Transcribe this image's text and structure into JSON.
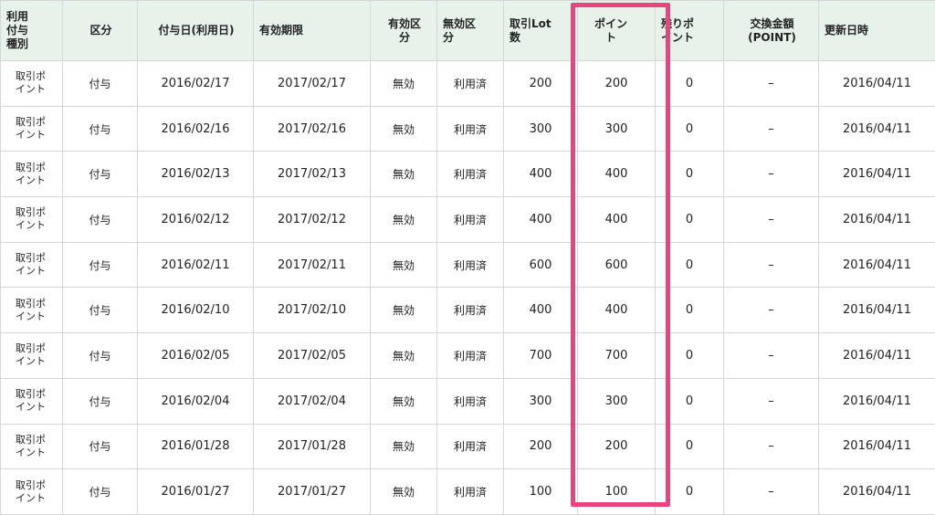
{
  "table": {
    "headers": [
      "利用\n付与\n種別",
      "区分",
      "付与日(利用日)",
      "有効期限",
      "有効区\n分",
      "無効区\n分",
      "取引Lot\n数",
      "ポイン\nト",
      "残りポ\nイント",
      "交換金額\n(POINT)",
      "更新日時"
    ],
    "rows": [
      [
        "取引ポ\nイント",
        "付与",
        "2016/02/17",
        "2017/02/17",
        "無効",
        "利用済",
        "200",
        "200",
        "0",
        "–",
        "2016/04/11"
      ],
      [
        "取引ポ\nイント",
        "付与",
        "2016/02/16",
        "2017/02/16",
        "無効",
        "利用済",
        "300",
        "300",
        "0",
        "–",
        "2016/04/11"
      ],
      [
        "取引ポ\nイント",
        "付与",
        "2016/02/13",
        "2017/02/13",
        "無効",
        "利用済",
        "400",
        "400",
        "0",
        "–",
        "2016/04/11"
      ],
      [
        "取引ポ\nイント",
        "付与",
        "2016/02/12",
        "2017/02/12",
        "無効",
        "利用済",
        "400",
        "400",
        "0",
        "–",
        "2016/04/11"
      ],
      [
        "取引ポ\nイント",
        "付与",
        "2016/02/11",
        "2017/02/11",
        "無効",
        "利用済",
        "600",
        "600",
        "0",
        "–",
        "2016/04/11"
      ],
      [
        "取引ポ\nイント",
        "付与",
        "2016/02/10",
        "2017/02/10",
        "無効",
        "利用済",
        "400",
        "400",
        "0",
        "–",
        "2016/04/11"
      ],
      [
        "取引ポ\nイント",
        "付与",
        "2016/02/05",
        "2017/02/05",
        "無効",
        "利用済",
        "700",
        "700",
        "0",
        "–",
        "2016/04/11"
      ],
      [
        "取引ポ\nイント",
        "付与",
        "2016/02/04",
        "2017/02/04",
        "無効",
        "利用済",
        "300",
        "300",
        "0",
        "–",
        "2016/04/11"
      ],
      [
        "取引ポ\nイント",
        "付与",
        "2016/01/28",
        "2017/01/28",
        "無効",
        "利用済",
        "200",
        "200",
        "0",
        "–",
        "2016/04/11"
      ],
      [
        "取引ポ\nイント",
        "付与",
        "2016/01/27",
        "2017/01/27",
        "無効",
        "利用済",
        "100",
        "100",
        "0",
        "–",
        "2016/04/11"
      ]
    ]
  },
  "colors": {
    "header_background": "#e6f2ea",
    "border": "#d6d6d6",
    "highlight": "#e8457f"
  }
}
